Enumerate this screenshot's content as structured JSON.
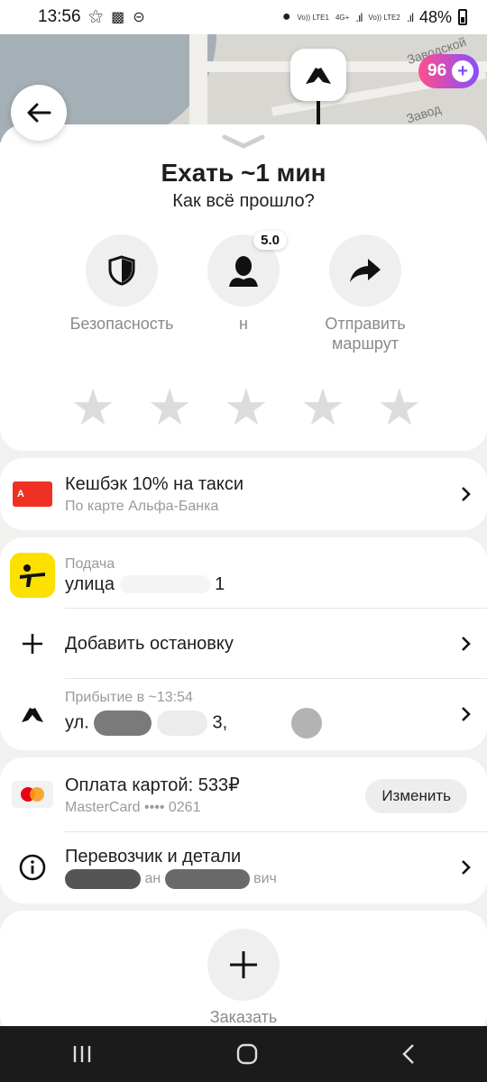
{
  "status_bar": {
    "time": "13:56",
    "network1": "Vo)) LTE1",
    "network_type": "4G+",
    "network2": "Vo)) LTE2",
    "battery": "48%"
  },
  "map": {
    "street_label_1": "Заводской",
    "street_label_2": "Завод",
    "plus_points": "96"
  },
  "trip": {
    "title": "Ехать ~1 мин",
    "subtitle": "Как всё прошло?"
  },
  "actions": [
    {
      "label": "Безопасность",
      "icon": "shield-icon"
    },
    {
      "label": "н",
      "icon": "driver-avatar-icon",
      "rating": "5.0"
    },
    {
      "label": "Отправить маршрут",
      "icon": "share-arrow-icon"
    }
  ],
  "rating": {
    "stars": 5,
    "selected": 0
  },
  "cashback": {
    "title": "Кешбэк 10% на такси",
    "subtitle": "По карте Альфа-Банка",
    "bank_letter": "А"
  },
  "route": {
    "pickup_label": "Подача",
    "pickup_address": "улица",
    "pickup_tail": "1",
    "add_stop": "Добавить остановку",
    "arrival_label": "Прибытие в ~13:54",
    "arrival_address": "ул.",
    "arrival_mid": "3,"
  },
  "payment": {
    "title": "Оплата картой: 533₽",
    "card": "MasterCard •••• 0261",
    "change_label": "Изменить"
  },
  "carrier": {
    "title": "Перевозчик и детали",
    "sub_mid": "ан",
    "sub_tail": "вич"
  },
  "order": {
    "label": "Заказать"
  },
  "colors": {
    "accent_yellow": "#fce000",
    "alfa_red": "#ef3124",
    "plus_gradient_start": "#ff4f8b",
    "plus_gradient_end": "#8a4dff"
  }
}
